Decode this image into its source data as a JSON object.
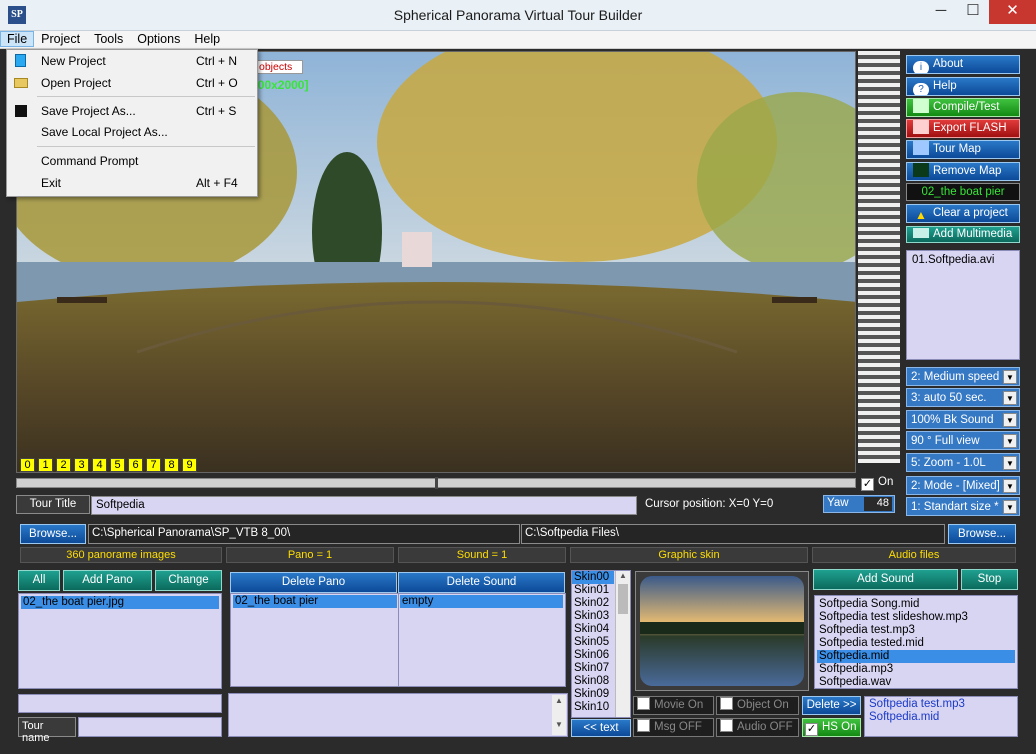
{
  "window": {
    "title": "Spherical Panorama Virtual Tour Builder",
    "app_icon": "SP",
    "controls": {
      "minimize": "─",
      "maximize": "☐",
      "close": "✕"
    }
  },
  "menubar": {
    "items": [
      "File",
      "Project",
      "Tools",
      "Options",
      "Help"
    ]
  },
  "file_menu": {
    "items": [
      {
        "label": "New Project",
        "shortcut": "Ctrl + N",
        "icon": "new-file-icon"
      },
      {
        "label": "Open Project",
        "shortcut": "Ctrl + O",
        "icon": "open-folder-icon"
      },
      {
        "label": "Save Project As...",
        "shortcut": "Ctrl + S",
        "icon": "save-icon"
      },
      {
        "label": "Save Local Project As...",
        "shortcut": ""
      },
      {
        "label": "Command Prompt",
        "shortcut": ""
      },
      {
        "label": "Exit",
        "shortcut": "Alt + F4"
      }
    ]
  },
  "viewer": {
    "objects_label": "objects",
    "path_overlay": "ama\\SP_VTB 8_00\\02_the boat pier.jpg [4000x2000]",
    "number_buttons": [
      "0",
      "1",
      "2",
      "3",
      "4",
      "5",
      "6",
      "7",
      "8",
      "9"
    ],
    "on_label": "On",
    "colors": {
      "path_text": "#37e637",
      "number_bg": "#ffff00"
    }
  },
  "right_panel": {
    "buttons": {
      "about": "About",
      "help": "Help",
      "compile": "Compile/Test",
      "export": "Export FLASH",
      "tour_map": "Tour Map",
      "remove_map": "Remove Map",
      "current_pano": "02_the boat pier",
      "clear": "Clear a project",
      "add_multimedia": "Add Multimedia"
    },
    "multimedia_list": [
      "01.Softpedia.avi"
    ],
    "dropdowns": [
      "2: Medium speed",
      "3: auto 50 sec.",
      "100% Bk Sound",
      "90 ° Full view",
      "5: Zoom - 1.0L",
      "2: Mode - [Mixed]",
      "1: Standart size *"
    ]
  },
  "tour": {
    "title_label": "Tour Title",
    "title_value": "Softpedia",
    "cursor_label": "Cursor position: X=0  Y=0",
    "yaw_label": "Yaw",
    "yaw_value": "48"
  },
  "paths": {
    "browse_label": "Browse...",
    "left_path": "C:\\Spherical Panorama\\SP_VTB 8_00\\",
    "right_path": "C:\\Softpedia Files\\",
    "browse_right_label": "Browse..."
  },
  "status": {
    "pano_images": "360 panorame images",
    "pano_count": "Pano =  1",
    "sound_count": "Sound =  1",
    "graphic_skin": "Graphic skin",
    "audio_files": "Audio files"
  },
  "pano_panel": {
    "all": "All",
    "add_pano": "Add Pano",
    "change": "Change",
    "items": [
      "02_the boat pier.jpg"
    ],
    "tour_name_label": "Tour name"
  },
  "hotspots": {
    "delete_pano": "Delete Pano",
    "delete_sound": "Delete Sound",
    "pano_items": [
      "02_the boat pier"
    ],
    "sound_items": [
      "empty"
    ]
  },
  "skins": {
    "items": [
      "Skin00",
      "Skin01",
      "Skin02",
      "Skin03",
      "Skin04",
      "Skin05",
      "Skin06",
      "Skin07",
      "Skin08",
      "Skin09",
      "Skin10"
    ],
    "selected": "Skin00",
    "text_button": "<< text"
  },
  "toggles": {
    "movie_on": "Movie On",
    "object_on": "Object On",
    "msg_off": "Msg OFF",
    "audio_off": "Audio OFF",
    "delete": "Delete >>",
    "hs_on": "HS On"
  },
  "audio": {
    "add_sound": "Add Sound",
    "stop": "Stop",
    "files": [
      "Softpedia Song.mid",
      "Softpedia test slideshow.mp3",
      "Softpedia test.mp3",
      "Softpedia tested.mid",
      "Softpedia.mid",
      "Softpedia.mp3",
      "Softpedia.wav"
    ],
    "selected": "Softpedia.mid",
    "playlist": [
      "Softpedia test.mp3",
      "Softpedia.mid"
    ]
  }
}
